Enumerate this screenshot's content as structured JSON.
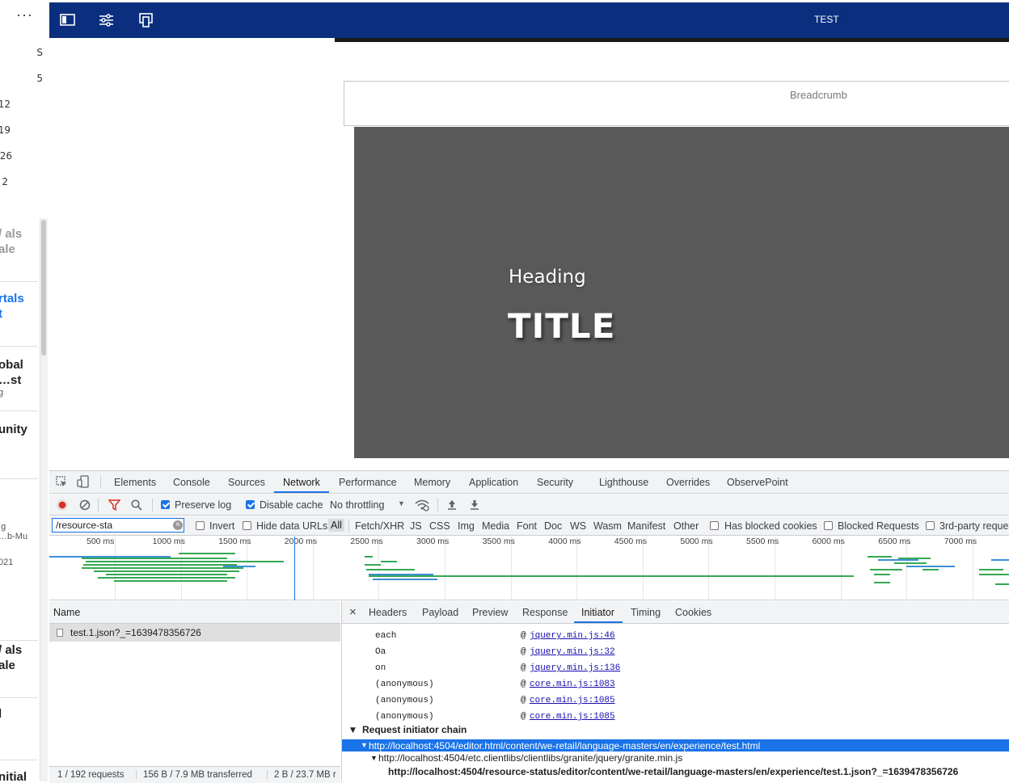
{
  "sidebar": {
    "more": "···",
    "numbers": [
      "S",
      "5",
      "12",
      "19",
      "26",
      "2"
    ],
    "cards": [
      {
        "title1": "als /",
        "title2": "ale",
        "sub": "",
        "color": "#999999"
      },
      {
        "title1": "rtals",
        "title2": "t",
        "sub": "",
        "color": "#1a73e8"
      },
      {
        "title1": "obal",
        "title2": "st…",
        "sub": "g",
        "color": "#202124"
      },
      {
        "title1": "unity",
        "title2": "",
        "sub": "",
        "color": "#202124"
      },
      {
        "title1": "",
        "title2": "",
        "sub": "g;",
        "sub2": "b-Mu…",
        "sub3": "021",
        "color": "#202124"
      },
      {
        "title1": "als /",
        "title2": "ale",
        "sub": "",
        "color": "#202124"
      },
      {
        "title1": "l",
        "title2": "",
        "sub": "",
        "color": "#202124"
      },
      {
        "title1": "nitial",
        "title2": "",
        "sub": "",
        "color": "#202124"
      }
    ]
  },
  "header": {
    "title": "TEST"
  },
  "page": {
    "breadcrumb": "Breadcrumb",
    "heading": "Heading",
    "title": "TITLE"
  },
  "devtools": {
    "tabs": [
      "Elements",
      "Console",
      "Sources",
      "Network",
      "Performance",
      "Memory",
      "Application",
      "Security",
      "Lighthouse",
      "Overrides",
      "ObservePoint"
    ],
    "active_tab": "Network",
    "toolbar": {
      "preserve_log": "Preserve log",
      "disable_cache": "Disable cache",
      "throttling": "No throttling"
    },
    "filter": {
      "value": "/resource-sta",
      "invert": "Invert",
      "hide_data_urls": "Hide data URLs",
      "types": [
        "All",
        "Fetch/XHR",
        "JS",
        "CSS",
        "Img",
        "Media",
        "Font",
        "Doc",
        "WS",
        "Wasm",
        "Manifest",
        "Other"
      ],
      "has_blocked_cookies": "Has blocked cookies",
      "blocked_requests": "Blocked Requests",
      "third_party": "3rd-party reques"
    },
    "timeline_ticks": [
      "500 ms",
      "1000 ms",
      "1500 ms",
      "2000 ms",
      "2500 ms",
      "3000 ms",
      "3500 ms",
      "4000 ms",
      "4500 ms",
      "5000 ms",
      "5500 ms",
      "6000 ms",
      "6500 ms",
      "7000 ms"
    ],
    "name_header": "Name",
    "request": "test.1.json?_=1639478356726",
    "status": {
      "requests": "1 / 192 requests",
      "transferred": "156 B / 7.9 MB transferred",
      "resources": "2 B / 23.7 MB r"
    },
    "detail_tabs": [
      "Headers",
      "Payload",
      "Preview",
      "Response",
      "Initiator",
      "Timing",
      "Cookies"
    ],
    "active_detail_tab": "Initiator",
    "close": "×",
    "stack": [
      {
        "fn": "each",
        "at": "@",
        "link": "jquery.min.js:46"
      },
      {
        "fn": "Oa",
        "at": "@",
        "link": "jquery.min.js:32"
      },
      {
        "fn": "on",
        "at": "@",
        "link": "jquery.min.js:136"
      },
      {
        "fn": "(anonymous)",
        "at": "@",
        "link": "core.min.js:1083"
      },
      {
        "fn": "(anonymous)",
        "at": "@",
        "link": "core.min.js:1085"
      },
      {
        "fn": "(anonymous)",
        "at": "@",
        "link": "core.min.js:1085"
      }
    ],
    "chain_header": "Request initiator chain",
    "chain": [
      "http://localhost:4504/editor.html/content/we-retail/language-masters/en/experience/test.html",
      "http://localhost:4504/etc.clientlibs/clientlibs/granite/jquery/granite.min.js",
      "http://localhost:4504/resource-status/editor/content/we-retail/language-masters/en/experience/test.1.json?_=1639478356726"
    ]
  },
  "colors": {
    "header_bg": "#0b2f7e",
    "hero_bg": "#595959",
    "accent": "#1a73e8"
  }
}
